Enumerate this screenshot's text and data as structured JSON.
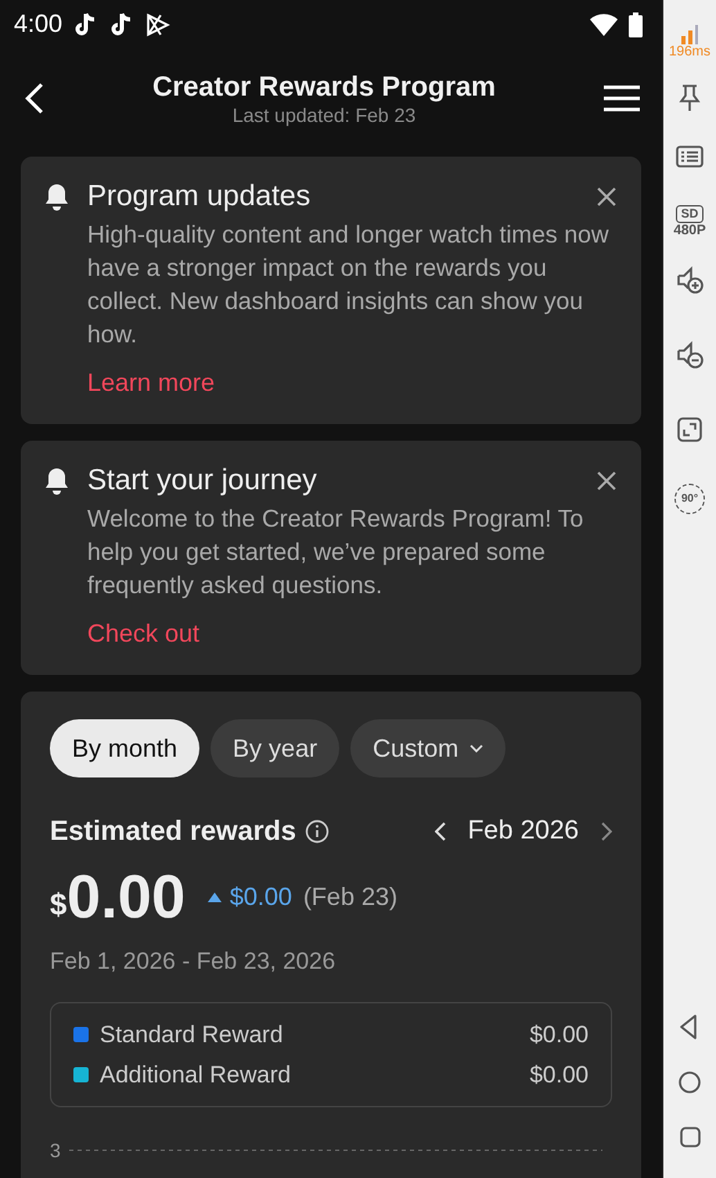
{
  "status_bar": {
    "time": "4:00"
  },
  "header": {
    "title": "Creator Rewards Program",
    "subtitle": "Last updated: Feb 23"
  },
  "notices": [
    {
      "title": "Program updates",
      "body": "High-quality content and longer watch times now have a stronger impact on the rewards you collect. New dashboard insights can show you how.",
      "link": "Learn more"
    },
    {
      "title": "Start your journey",
      "body": "Welcome to the Creator Rewards Program! To help you get started, we’ve prepared some frequently asked questions.",
      "link": "Check out"
    }
  ],
  "rewards": {
    "filters": [
      {
        "label": "By month",
        "selected": true,
        "kind": "toggle"
      },
      {
        "label": "By year",
        "selected": false,
        "kind": "toggle"
      },
      {
        "label": "Custom",
        "selected": false,
        "kind": "dropdown"
      }
    ],
    "title": "Estimated rewards",
    "period": "Feb 2026",
    "currency": "$",
    "amount": "0.00",
    "change": "$0.00",
    "change_date": "(Feb 23)",
    "range": "Feb 1, 2026 - Feb 23, 2026",
    "legend": [
      {
        "name": "Standard Reward",
        "value": "$0.00",
        "color": "#1a73e8"
      },
      {
        "name": "Additional Reward",
        "value": "$0.00",
        "color": "#16b4d4"
      }
    ],
    "chart_tick": "3"
  },
  "side_toolbar": {
    "latency": "196ms",
    "quality_badge": "SD",
    "quality": "480P",
    "rotate_label": "90°"
  }
}
